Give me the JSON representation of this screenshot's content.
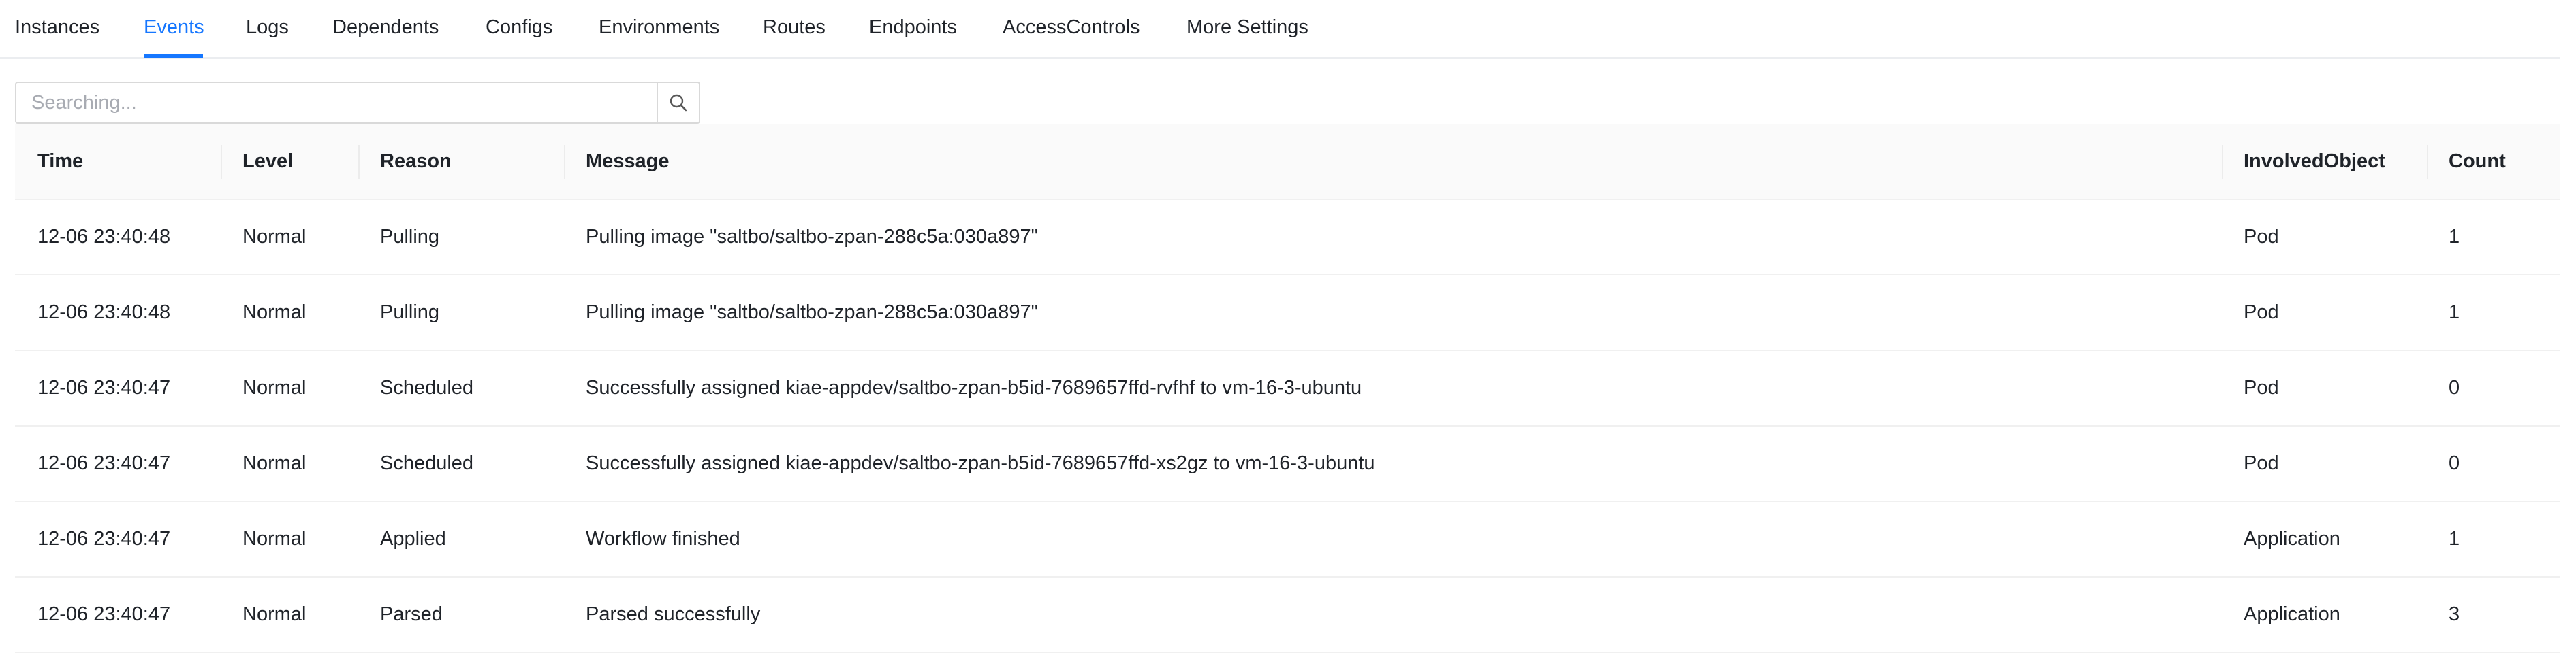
{
  "tabs": [
    {
      "label": "Instances",
      "active": false
    },
    {
      "label": "Events",
      "active": true
    },
    {
      "label": "Logs",
      "active": false
    },
    {
      "label": "Dependents",
      "active": false
    },
    {
      "label": "Configs",
      "active": false
    },
    {
      "label": "Environments",
      "active": false
    },
    {
      "label": "Routes",
      "active": false
    },
    {
      "label": "Endpoints",
      "active": false
    },
    {
      "label": "AccessControls",
      "active": false
    },
    {
      "label": "More Settings",
      "active": false
    }
  ],
  "search": {
    "placeholder": "Searching...",
    "value": "",
    "icon": "search-icon"
  },
  "table": {
    "columns": [
      "Time",
      "Level",
      "Reason",
      "Message",
      "InvolvedObject",
      "Count"
    ],
    "rows": [
      {
        "time": "12-06 23:40:48",
        "level": "Normal",
        "reason": "Pulling",
        "message": "Pulling image \"saltbo/saltbo-zpan-288c5a:030a897\"",
        "object": "Pod",
        "count": "1"
      },
      {
        "time": "12-06 23:40:48",
        "level": "Normal",
        "reason": "Pulling",
        "message": "Pulling image \"saltbo/saltbo-zpan-288c5a:030a897\"",
        "object": "Pod",
        "count": "1"
      },
      {
        "time": "12-06 23:40:47",
        "level": "Normal",
        "reason": "Scheduled",
        "message": "Successfully assigned kiae-appdev/saltbo-zpan-b5id-7689657ffd-rvfhf to vm-16-3-ubuntu",
        "object": "Pod",
        "count": "0"
      },
      {
        "time": "12-06 23:40:47",
        "level": "Normal",
        "reason": "Scheduled",
        "message": "Successfully assigned kiae-appdev/saltbo-zpan-b5id-7689657ffd-xs2gz to vm-16-3-ubuntu",
        "object": "Pod",
        "count": "0"
      },
      {
        "time": "12-06 23:40:47",
        "level": "Normal",
        "reason": "Applied",
        "message": "Workflow finished",
        "object": "Application",
        "count": "1"
      },
      {
        "time": "12-06 23:40:47",
        "level": "Normal",
        "reason": "Parsed",
        "message": "Parsed successfully",
        "object": "Application",
        "count": "3"
      }
    ]
  },
  "colors": {
    "accent": "#1677ff",
    "header_bg": "#fafafa",
    "border": "#f0f0f0"
  }
}
